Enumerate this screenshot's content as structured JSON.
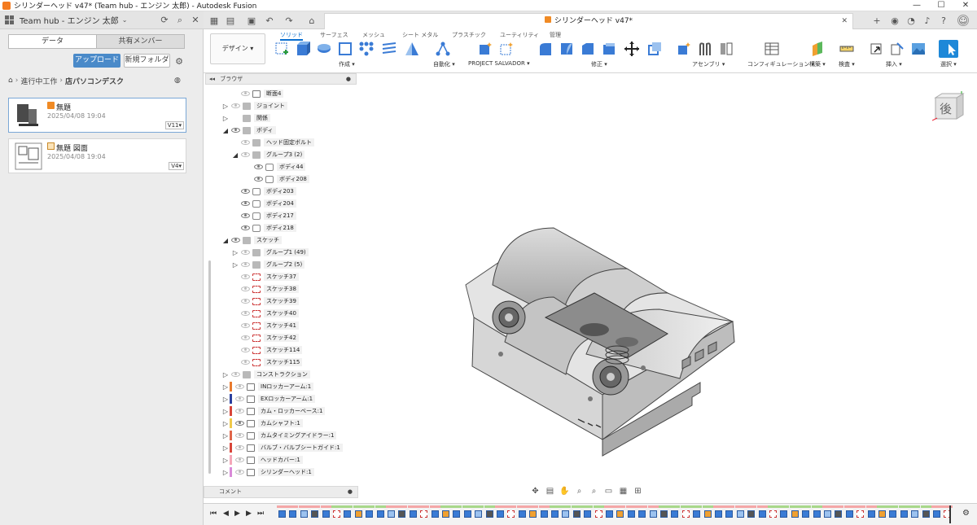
{
  "window": {
    "title": "シリンダーヘッド v47* (Team hub - エンジン 太郎) - Autodesk Fusion",
    "controls": [
      "—",
      "☐",
      "✕"
    ]
  },
  "hub": {
    "name": "Team hub - エンジン 太郎",
    "tabs": [
      "データ",
      "共有メンバー"
    ],
    "upload_label": "アップロード",
    "new_folder_label": "新規フォルダ",
    "breadcrumb": [
      "進行中工作",
      "店パソコンデスク"
    ],
    "files": [
      {
        "name": "無題",
        "date": "2025/04/08 19:04",
        "version": "V11"
      },
      {
        "name": "無題 図面",
        "date": "2025/04/08 19:04",
        "version": "V4"
      }
    ]
  },
  "document_tab": {
    "title": "シリンダーヘッド v47*"
  },
  "toolbar": {
    "workspace": "デザイン",
    "tabs": [
      "ソリッド",
      "サーフェス",
      "メッシュ",
      "シート メタル",
      "プラスチック",
      "ユーティリティ",
      "管理"
    ],
    "active_tab": "ソリッド",
    "groups": [
      "作成",
      "自動化",
      "PROJECT SALVADOR",
      "修正",
      "アセンブリ",
      "コンフィギュレーション",
      "構築",
      "検査",
      "挿入",
      "選択"
    ]
  },
  "browser": {
    "title": "ブラウザ",
    "items": [
      {
        "label": "断面4",
        "level": 2,
        "arrow": "",
        "eye": false,
        "icon": "cmp"
      },
      {
        "label": "ジョイント",
        "level": 1,
        "arrow": "▷",
        "eye": false,
        "icon": "fold"
      },
      {
        "label": "関係",
        "level": 1,
        "arrow": "▷",
        "eye": null,
        "icon": "fold"
      },
      {
        "label": "ボディ",
        "level": 1,
        "arrow": "◢",
        "eye": true,
        "icon": "fold"
      },
      {
        "label": "ヘッド固定ボルト",
        "level": 2,
        "arrow": "",
        "eye": false,
        "icon": "fold"
      },
      {
        "label": "グループ3 (2)",
        "level": 2,
        "arrow": "◢",
        "eye": false,
        "icon": "fold"
      },
      {
        "label": "ボディ44",
        "level": 3,
        "arrow": "",
        "eye": true,
        "icon": "body"
      },
      {
        "label": "ボディ208",
        "level": 3,
        "arrow": "",
        "eye": true,
        "icon": "body"
      },
      {
        "label": "ボディ203",
        "level": 2,
        "arrow": "",
        "eye": true,
        "icon": "body"
      },
      {
        "label": "ボディ204",
        "level": 2,
        "arrow": "",
        "eye": true,
        "icon": "body"
      },
      {
        "label": "ボディ217",
        "level": 2,
        "arrow": "",
        "eye": true,
        "icon": "body"
      },
      {
        "label": "ボディ218",
        "level": 2,
        "arrow": "",
        "eye": true,
        "icon": "body"
      },
      {
        "label": "スケッチ",
        "level": 1,
        "arrow": "◢",
        "eye": true,
        "icon": "fold"
      },
      {
        "label": "グループ1 (49)",
        "level": 2,
        "arrow": "▷",
        "eye": false,
        "icon": "fold"
      },
      {
        "label": "グループ2 (5)",
        "level": 2,
        "arrow": "▷",
        "eye": false,
        "icon": "fold"
      },
      {
        "label": "スケッチ37",
        "level": 2,
        "arrow": "",
        "eye": false,
        "icon": "sk"
      },
      {
        "label": "スケッチ38",
        "level": 2,
        "arrow": "",
        "eye": false,
        "icon": "sk"
      },
      {
        "label": "スケッチ39",
        "level": 2,
        "arrow": "",
        "eye": false,
        "icon": "sk"
      },
      {
        "label": "スケッチ40",
        "level": 2,
        "arrow": "",
        "eye": false,
        "icon": "sk"
      },
      {
        "label": "スケッチ41",
        "level": 2,
        "arrow": "",
        "eye": false,
        "icon": "sk"
      },
      {
        "label": "スケッチ42",
        "level": 2,
        "arrow": "",
        "eye": false,
        "icon": "sk"
      },
      {
        "label": "スケッチ114",
        "level": 2,
        "arrow": "",
        "eye": false,
        "icon": "sk"
      },
      {
        "label": "スケッチ115",
        "level": 2,
        "arrow": "",
        "eye": false,
        "icon": "sk"
      },
      {
        "label": "コンストラクション",
        "level": 1,
        "arrow": "▷",
        "eye": false,
        "icon": "fold"
      },
      {
        "label": "INロッカーアーム:1",
        "level": 1,
        "arrow": "▷",
        "eye": false,
        "icon": "cmp",
        "color": "#e87a2e"
      },
      {
        "label": "EXロッカーアーム:1",
        "level": 1,
        "arrow": "▷",
        "eye": false,
        "icon": "cmp",
        "color": "#2b3f9e"
      },
      {
        "label": "カム・ロッカーベース:1",
        "level": 1,
        "arrow": "▷",
        "eye": false,
        "icon": "cmp",
        "color": "#d8453a"
      },
      {
        "label": "カムシャフト:1",
        "level": 1,
        "arrow": "▷",
        "eye": true,
        "icon": "cmp",
        "color": "#f0c94a"
      },
      {
        "label": "カムタイミングアイドラー:1",
        "level": 1,
        "arrow": "▷",
        "eye": false,
        "icon": "cmp",
        "color": "#e0664a"
      },
      {
        "label": "バルブ・バルブシートガイド:1",
        "level": 1,
        "arrow": "▷",
        "eye": false,
        "icon": "cmp",
        "color": "#d8453a"
      },
      {
        "label": "ヘッドカバー:1",
        "level": 1,
        "arrow": "▷",
        "eye": false,
        "icon": "cmp",
        "color": "#f5a7b8"
      },
      {
        "label": "シリンダーヘッド:1",
        "level": 1,
        "arrow": "▷",
        "eye": false,
        "icon": "cmp",
        "color": "#d98ad8"
      }
    ]
  },
  "comment": {
    "label": "コメント"
  },
  "viewcube": {
    "face": "後"
  },
  "colors": {
    "accent": "#0b6fcf",
    "upload": "#4a8ac9",
    "brand": "#f47b20"
  }
}
